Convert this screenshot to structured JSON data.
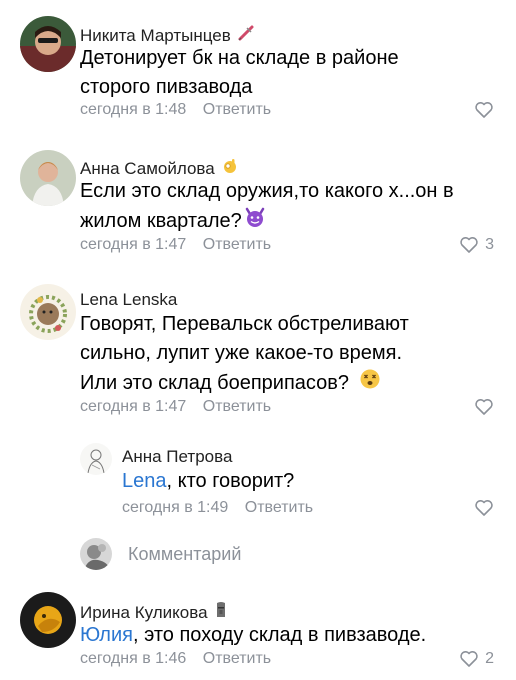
{
  "comments": [
    {
      "author": "Никита Мартынцев",
      "author_emoji": "syringe-icon",
      "text_lines": [
        "Детонирует бк на складе в районе",
        "сторого пивзавода"
      ],
      "time": "сегодня в 1:48",
      "reply_label": "Ответить",
      "likes": ""
    },
    {
      "author": "Анна Самойлова",
      "author_emoji": "ok-hand-icon",
      "text_lines": [
        "Если это склад оружия,то какого х...он в",
        "жилом квартале?"
      ],
      "text_emoji": "devil-face-icon",
      "time": "сегодня в 1:47",
      "reply_label": "Ответить",
      "likes": "3"
    },
    {
      "author": "Lena Lenska",
      "text_lines": [
        "Говорят, Перевальск обстреливают",
        "сильно, лупит уже какое-то время.",
        "Или это склад боеприпасов?"
      ],
      "text_emoji": "dizzy-face-icon",
      "time": "сегодня в 1:47",
      "reply_label": "Ответить",
      "likes": ""
    },
    {
      "author": "Анна Петрова",
      "mention": "Lena",
      "text_rest": ", кто говорит?",
      "time": "сегодня в 1:49",
      "reply_label": "Ответить",
      "likes": ""
    },
    {
      "author": "Ирина Куликова",
      "author_emoji": "moai-icon",
      "mention": "Юлия",
      "text_rest": ", это походу склад в пивзаводе.",
      "time": "сегодня в 1:46",
      "reply_label": "Ответить",
      "likes": "2"
    }
  ],
  "compose": {
    "placeholder": "Комментарий"
  },
  "colors": {
    "meta": "#8c9199",
    "mention": "#2a76d1",
    "text": "#000000"
  }
}
